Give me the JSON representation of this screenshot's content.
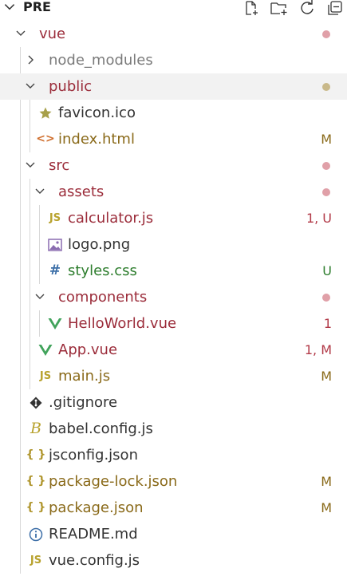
{
  "header": {
    "title": "PRE",
    "actions": [
      {
        "name": "new-file-icon"
      },
      {
        "name": "new-folder-icon"
      },
      {
        "name": "refresh-icon"
      },
      {
        "name": "collapse-all-icon"
      }
    ]
  },
  "tree": [
    {
      "label": "vue",
      "kind": "folder",
      "expanded": true,
      "deco": "",
      "dot": "#e0a0a8",
      "color": "red"
    },
    {
      "label": "node_modules",
      "kind": "folder",
      "expanded": false,
      "deco": "",
      "dot": "",
      "color": "gray"
    },
    {
      "label": "public",
      "kind": "folder",
      "expanded": true,
      "deco": "",
      "dot": "#c9b98a",
      "color": "red",
      "selected": true
    },
    {
      "label": "favicon.ico",
      "kind": "file",
      "icon": "star-icon",
      "deco": "",
      "dot": "",
      "color": "dark"
    },
    {
      "label": "index.html",
      "kind": "file",
      "icon": "html-icon",
      "deco": "M",
      "dot": "",
      "color": "mod"
    },
    {
      "label": "src",
      "kind": "folder",
      "expanded": true,
      "deco": "",
      "dot": "#e0a0a8",
      "color": "red"
    },
    {
      "label": "assets",
      "kind": "folder",
      "expanded": true,
      "deco": "",
      "dot": "#e0a0a8",
      "color": "red"
    },
    {
      "label": "calculator.js",
      "kind": "file",
      "icon": "js-icon",
      "deco": "1, U",
      "dot": "",
      "color": "red"
    },
    {
      "label": "logo.png",
      "kind": "file",
      "icon": "image-icon",
      "deco": "",
      "dot": "",
      "color": "dark"
    },
    {
      "label": "styles.css",
      "kind": "file",
      "icon": "css-icon",
      "deco": "U",
      "dot": "",
      "color": "green"
    },
    {
      "label": "components",
      "kind": "folder",
      "expanded": true,
      "deco": "",
      "dot": "#e0a0a8",
      "color": "red"
    },
    {
      "label": "HelloWorld.vue",
      "kind": "file",
      "icon": "vue-icon",
      "deco": "1",
      "dot": "",
      "color": "red"
    },
    {
      "label": "App.vue",
      "kind": "file",
      "icon": "vue-icon",
      "deco": "1, M",
      "dot": "",
      "color": "red"
    },
    {
      "label": "main.js",
      "kind": "file",
      "icon": "js-icon",
      "deco": "M",
      "dot": "",
      "color": "mod"
    },
    {
      "label": ".gitignore",
      "kind": "file",
      "icon": "git-icon",
      "deco": "",
      "dot": "",
      "color": "dark"
    },
    {
      "label": "babel.config.js",
      "kind": "file",
      "icon": "babel-icon",
      "deco": "",
      "dot": "",
      "color": "dark"
    },
    {
      "label": "jsconfig.json",
      "kind": "file",
      "icon": "json-icon",
      "deco": "",
      "dot": "",
      "color": "dark"
    },
    {
      "label": "package-lock.json",
      "kind": "file",
      "icon": "json-icon",
      "deco": "M",
      "dot": "",
      "color": "mod"
    },
    {
      "label": "package.json",
      "kind": "file",
      "icon": "json-icon",
      "deco": "M",
      "dot": "",
      "color": "mod"
    },
    {
      "label": "README.md",
      "kind": "file",
      "icon": "info-icon",
      "deco": "",
      "dot": "",
      "color": "dark"
    },
    {
      "label": "vue.config.js",
      "kind": "file",
      "icon": "js-icon",
      "deco": "",
      "dot": "",
      "color": "dark"
    }
  ],
  "colors": {
    "red": "#9b2c3a",
    "gray": "#7a7a7a",
    "dark": "#333333",
    "green": "#2d7d2d",
    "mod": "#8a6a1a",
    "deco_red": "#b23a48",
    "deco_green": "#2d7d2d",
    "deco_mod": "#8a6a1a",
    "js_icon": "#b8a22e",
    "vue_icon": "#41a35b",
    "css_icon": "#3d6fa8",
    "html_icon": "#d0702f",
    "json_icon": "#b0962e",
    "star_icon": "#a7a04a",
    "image_icon": "#8a6cb0",
    "git_icon": "#333333",
    "babel_icon": "#b8a22e",
    "info_icon": "#3d6fa8"
  }
}
